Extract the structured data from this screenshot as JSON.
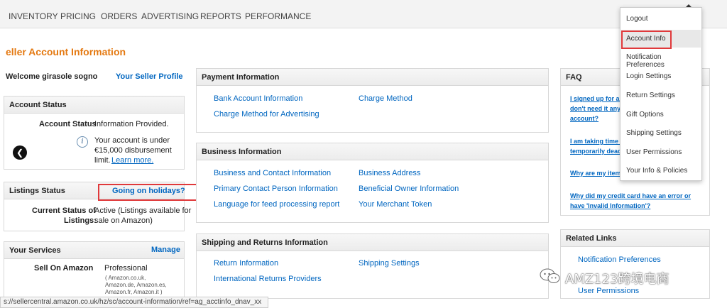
{
  "nav": {
    "items": [
      "INVENTORY",
      "PRICING",
      "ORDERS",
      "ADVERTISING",
      "REPORTS",
      "PERFORMANCE"
    ]
  },
  "page": {
    "title": "eller Account Information"
  },
  "welcome": {
    "text": "Welcome girasole sogno",
    "profile_link": "Your Seller Profile"
  },
  "account_status": {
    "header": "Account Status",
    "label": "Account Status",
    "value": "Information Provided.",
    "note_line1": "Your account is under",
    "note_line2": "€15,000 disbursement",
    "note_line3": "limit.",
    "learn_more": "Learn more."
  },
  "listings_status": {
    "header": "Listings Status",
    "holiday_link": "Going on holidays?",
    "label_line1": "Current Status of",
    "label_line2": "Listings:",
    "value_line1": "Active (Listings available for",
    "value_line2": "sale on Amazon)"
  },
  "services": {
    "header": "Your Services",
    "manage": "Manage",
    "label": "Sell On Amazon",
    "plan": "Professional",
    "sites_line1": "( Amazon.co.uk,",
    "sites_line2": "Amazon.de, Amazon.es,",
    "sites_line3": "Amazon.fr, Amazon.it )"
  },
  "payment": {
    "header": "Payment Information",
    "links": [
      "Bank Account Information",
      "Charge Method for Advertising",
      "Charge Method"
    ]
  },
  "business": {
    "header": "Business Information",
    "links": [
      "Business and Contact Information",
      "Primary Contact Person Information",
      "Language for feed processing report",
      "Business Address",
      "Beneficial Owner Information",
      "Your Merchant Token"
    ]
  },
  "shipping": {
    "header": "Shipping and Returns Information",
    "links": [
      "Return Information",
      "International Returns Providers",
      "Shipping Settings"
    ]
  },
  "faq": {
    "header": "FAQ",
    "q1_line1": "I signed up for an",
    "q1_line2": "don't need it anym",
    "q1_line3": "account?",
    "q2_line1": "I am taking time o",
    "q2_line2": "temporarily deac",
    "q3": "Why are my items",
    "q4_line1": "Why did my credit card have an error or",
    "q4_line2": "have 'Invalid Information'?"
  },
  "related": {
    "header": "Related Links",
    "links": [
      "Notification Preferences",
      "User Permissions"
    ]
  },
  "dropdown": {
    "items": [
      "Logout",
      "Account Info",
      "Notification Preferences",
      "Login Settings",
      "Return Settings",
      "Gift Options",
      "Shipping Settings",
      "User Permissions",
      "Your Info & Policies"
    ]
  },
  "statusbar": {
    "url": "s://sellercentral.amazon.co.uk/hz/sc/account-information/ref=ag_acctinfo_dnav_xx"
  },
  "watermark": {
    "text": "AMZ123跨境电商"
  },
  "icons": {
    "info": "info-icon",
    "back": "back-arrow-icon",
    "wechat": "wechat-icon"
  },
  "colors": {
    "title": "#e47911",
    "link": "#0066c0",
    "highlight_box": "#e0393b"
  }
}
